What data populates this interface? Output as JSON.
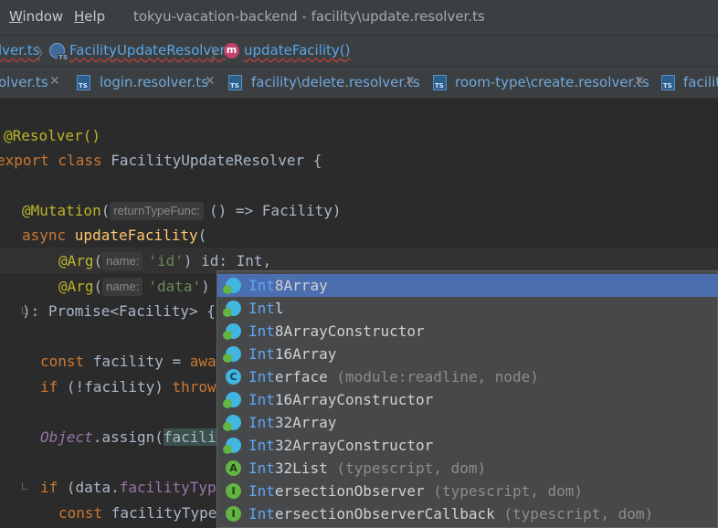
{
  "menu": {
    "window_first": "W",
    "window_rest": "indow",
    "help_first": "H",
    "help_rest": "elp"
  },
  "window_title": "tokyu-vacation-backend - facility\\update.resolver.ts",
  "breadcrumbs": {
    "file": "lver.ts",
    "class_name": "FacilityUpdateResolver",
    "method_icon_letter": "m",
    "method_name": "updateFacility()"
  },
  "tabs": [
    {
      "label": "olver.ts",
      "close": "✕"
    },
    {
      "label": "login.resolver.ts",
      "close": "✕"
    },
    {
      "label": "facility\\delete.resolver.ts",
      "close": "✕"
    },
    {
      "label": "room-type\\create.resolver.ts",
      "close": "✕"
    },
    {
      "label": "facilit"
    }
  ],
  "code": {
    "l1": "@Resolver()",
    "l2_kw": "export class ",
    "l2_name": "FacilityUpdateResolver {",
    "l3_an": "@Mutation",
    "l3_open": "(",
    "l3_hint": "returnTypeFunc:",
    "l3_rest": "() => Facility)",
    "l4_kw": "async ",
    "l4_fn": "updateFacility",
    "l4_rest": "(",
    "l5_an": "@Arg",
    "l5_open": "(",
    "l5_hint": "name:",
    "l5_str": "'id'",
    "l5_rest": ") id: Int,",
    "l6_an": "@Arg",
    "l6_open": "(",
    "l6_hint": "name:",
    "l6_str": "'data'",
    "l6_rest": ")",
    "l7": "): Promise<Facility> {",
    "l8_kw": "const ",
    "l8_rest": "facility = ",
    "l8_kw2": "awa",
    "l9_kw": "if ",
    "l9_rest": "(!facility) ",
    "l9_kw2": "throw",
    "l10_obj": "Object",
    "l10_rest": ".assign(",
    "l10_hl": "facili",
    "l11_kw": "if ",
    "l11_rest": "(data.",
    "l11_prop": "facilityTyp",
    "l12_kw": "const ",
    "l12_rest": "facilityType"
  },
  "completion": {
    "typed": "Int",
    "items": [
      {
        "icon": "var",
        "match": "Int",
        "rest": "8Array",
        "tail": ""
      },
      {
        "icon": "var",
        "match": "Int",
        "rest": "l",
        "tail": ""
      },
      {
        "icon": "var",
        "match": "Int",
        "rest": "8ArrayConstructor",
        "tail": ""
      },
      {
        "icon": "var",
        "match": "Int",
        "rest": "16Array",
        "tail": ""
      },
      {
        "icon": "class",
        "icon_letter": "C",
        "match": "Int",
        "rest": "erface",
        "tail": " (module:readline, node)"
      },
      {
        "icon": "var",
        "match": "Int",
        "rest": "16ArrayConstructor",
        "tail": ""
      },
      {
        "icon": "var",
        "match": "Int",
        "rest": "32Array",
        "tail": ""
      },
      {
        "icon": "var",
        "match": "Int",
        "rest": "32ArrayConstructor",
        "tail": ""
      },
      {
        "icon": "alias",
        "icon_letter": "A",
        "match": "Int",
        "rest": "32List",
        "tail": " (typescript, dom)"
      },
      {
        "icon": "interface",
        "icon_letter": "I",
        "match": "Int",
        "rest": "ersectionObserver",
        "tail": " (typescript, dom)"
      },
      {
        "icon": "interface",
        "icon_letter": "I",
        "match": "Int",
        "rest": "ersectionObserverCallback",
        "tail": " (typescript, dom)"
      }
    ]
  },
  "colors": {
    "background": "#2b2b2b",
    "keyword": "#cc7832",
    "annotation": "#bbb529",
    "function": "#ffc66d",
    "string": "#6a8759",
    "selection": "#4b6eaf"
  }
}
